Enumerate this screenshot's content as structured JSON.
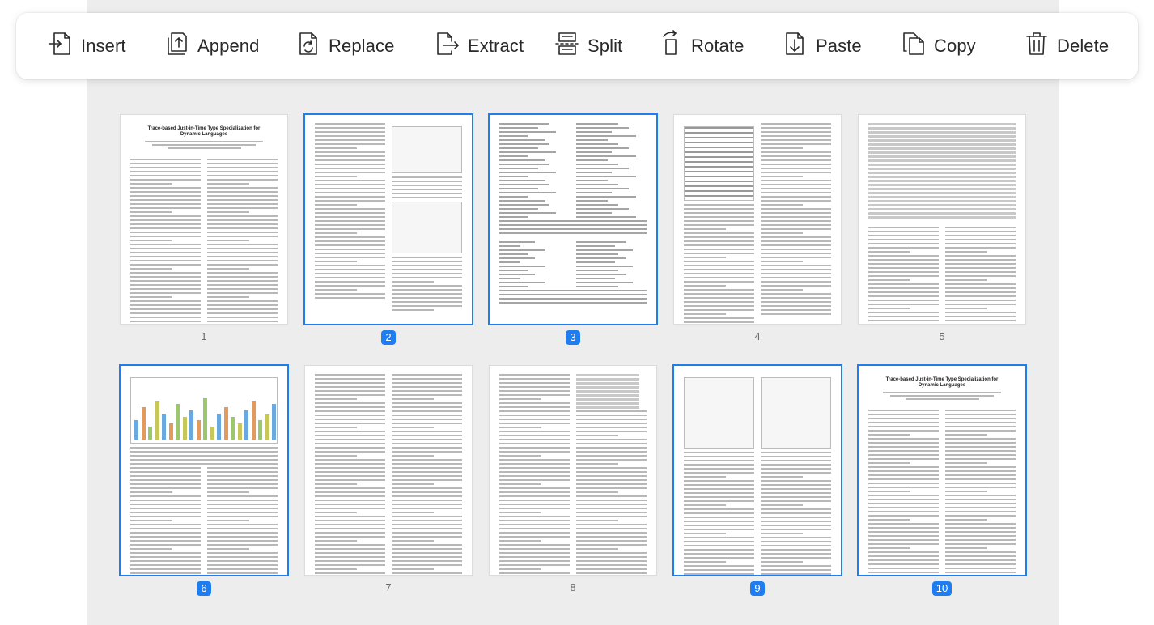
{
  "toolbar": {
    "items": [
      {
        "label": "Insert",
        "icon": "insert-icon"
      },
      {
        "label": "Append",
        "icon": "append-icon"
      },
      {
        "label": "Replace",
        "icon": "replace-icon"
      },
      {
        "label": "Extract",
        "icon": "extract-icon"
      },
      {
        "label": "Split",
        "icon": "split-icon"
      },
      {
        "label": "Rotate",
        "icon": "rotate-icon"
      },
      {
        "label": "Paste",
        "icon": "paste-icon"
      },
      {
        "label": "Copy",
        "icon": "copy-icon"
      },
      {
        "label": "Delete",
        "icon": "delete-icon"
      }
    ]
  },
  "pages": [
    {
      "number": "1",
      "selected": false,
      "title": "Trace-based Just-in-Time Type Specialization for Dynamic Languages",
      "kind": "title"
    },
    {
      "number": "2",
      "selected": true,
      "kind": "text-figure"
    },
    {
      "number": "3",
      "selected": true,
      "kind": "code"
    },
    {
      "number": "4",
      "selected": false,
      "kind": "chart-text"
    },
    {
      "number": "5",
      "selected": false,
      "kind": "table-text"
    },
    {
      "number": "6",
      "selected": true,
      "kind": "barchart-text"
    },
    {
      "number": "7",
      "selected": false,
      "kind": "text"
    },
    {
      "number": "8",
      "selected": false,
      "kind": "text-table"
    },
    {
      "number": "9",
      "selected": true,
      "kind": "diagram-text"
    },
    {
      "number": "10",
      "selected": true,
      "title": "Trace-based Just-in-Time Type Specialization for Dynamic Languages",
      "kind": "title"
    }
  ],
  "colors": {
    "selection": "#1e7df0",
    "background": "#ededed"
  }
}
